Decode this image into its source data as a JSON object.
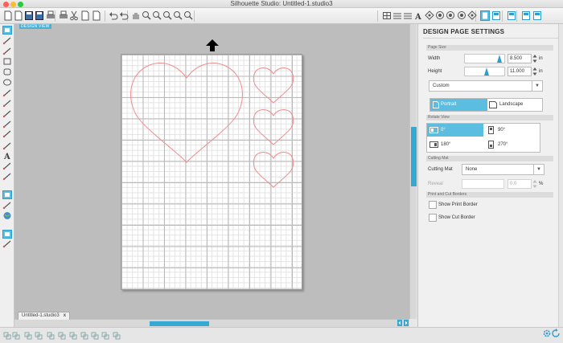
{
  "window": {
    "title": "Silhouette Studio: Untitled-1.studio3",
    "traffic_colors": [
      "#fc5f57",
      "#fdbc2e",
      "#28c840"
    ]
  },
  "toolbar": {
    "icons": [
      "new-document-icon",
      "open-icon",
      "save-icon",
      "save-to-library-icon",
      "print-icon",
      "print-cut-icon",
      "cut-icon",
      "copy-icon",
      "paste-icon",
      "undo-icon",
      "redo-icon",
      "pan-icon",
      "zoom-in-icon",
      "zoom-out-icon",
      "zoom-box-icon",
      "zoom-page-icon",
      "zoom-fit-icon",
      "grid-icon",
      "line-style-icon",
      "fill-icon",
      "text-style-icon",
      "transform-icon",
      "replicate-icon",
      "modify-icon",
      "offset-icon",
      "trace-icon",
      "page-settings-icon",
      "cut-settings-icon",
      "library-icon",
      "store-icon",
      "send-icon"
    ]
  },
  "canvas": {
    "design_view_label": "DESIGN VIEW",
    "heart_color": "#f08c8c",
    "accent": "#35a8d3"
  },
  "doc_tab": {
    "label": "Untitled-1.studio3",
    "close": "x"
  },
  "panel": {
    "title": "DESIGN PAGE SETTINGS",
    "page_size": {
      "section_label": "Page Size",
      "width_label": "Width",
      "width_value": "8.500",
      "height_label": "Height",
      "height_value": "11.000",
      "unit": "in",
      "size_preset": "Custom",
      "portrait_label": "Portrait",
      "landscape_label": "Landscape",
      "orientation_selected": "Portrait"
    },
    "rotate_view": {
      "section_label": "Rotate View",
      "options": [
        "0°",
        "90°",
        "180°",
        "270°"
      ],
      "selected": "0°"
    },
    "cutting_mat": {
      "section_label": "Cutting Mat",
      "label": "Cutting Mat",
      "value": "None",
      "reveal_label": "Reveal",
      "reveal_value": "0.0",
      "reveal_unit": "%"
    },
    "print_cut_borders": {
      "section_label": "Print and Cut Borders",
      "show_print_border": "Show Print Border",
      "show_cut_border": "Show Cut Border"
    }
  }
}
